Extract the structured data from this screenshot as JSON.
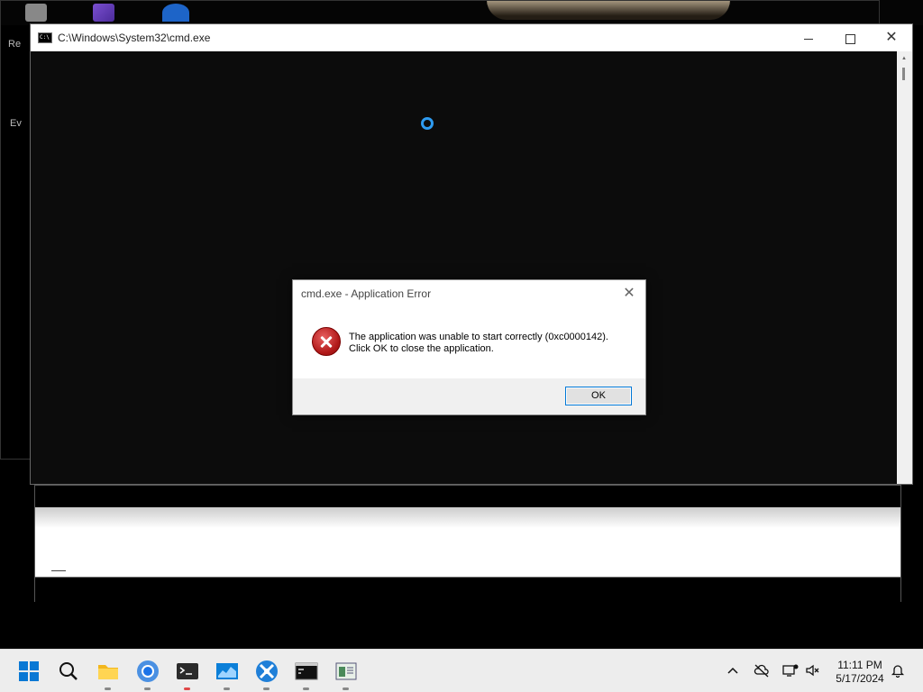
{
  "cmd_window": {
    "title": "C:\\Windows\\System32\\cmd.exe"
  },
  "dialog": {
    "title": "cmd.exe - Application Error",
    "message_line1": "The application was unable to start correctly (0xc0000142).",
    "message_line2": "Click OK to close the application.",
    "ok_label": "OK"
  },
  "desktop_labels": [
    "Re",
    "Ev"
  ],
  "taskbar": {
    "items": [
      {
        "name": "start",
        "icon": "windows-start-icon"
      },
      {
        "name": "search",
        "icon": "search-icon"
      },
      {
        "name": "file-explorer",
        "icon": "folder-icon"
      },
      {
        "name": "chrome",
        "icon": "chrome-icon"
      },
      {
        "name": "terminal",
        "icon": "terminal-icon",
        "active": true
      },
      {
        "name": "monitor-app",
        "icon": "chart-app-icon"
      },
      {
        "name": "network-app",
        "icon": "network-app-icon"
      },
      {
        "name": "cmd",
        "icon": "cmd-icon"
      },
      {
        "name": "notepad-app",
        "icon": "document-app-icon"
      }
    ],
    "tray": {
      "chevron": "chevron-up-icon",
      "cloud": "cloud-off-icon",
      "network": "network-icon",
      "volume": "volume-muted-icon",
      "bell": "notification-bell-icon"
    },
    "time": "11:11 PM",
    "date": "5/17/2024"
  },
  "colors": {
    "accent": "#0078d7",
    "spinner": "#2e9bf0",
    "error_red": "#c42b1c",
    "console_bg": "#0c0c0c"
  }
}
